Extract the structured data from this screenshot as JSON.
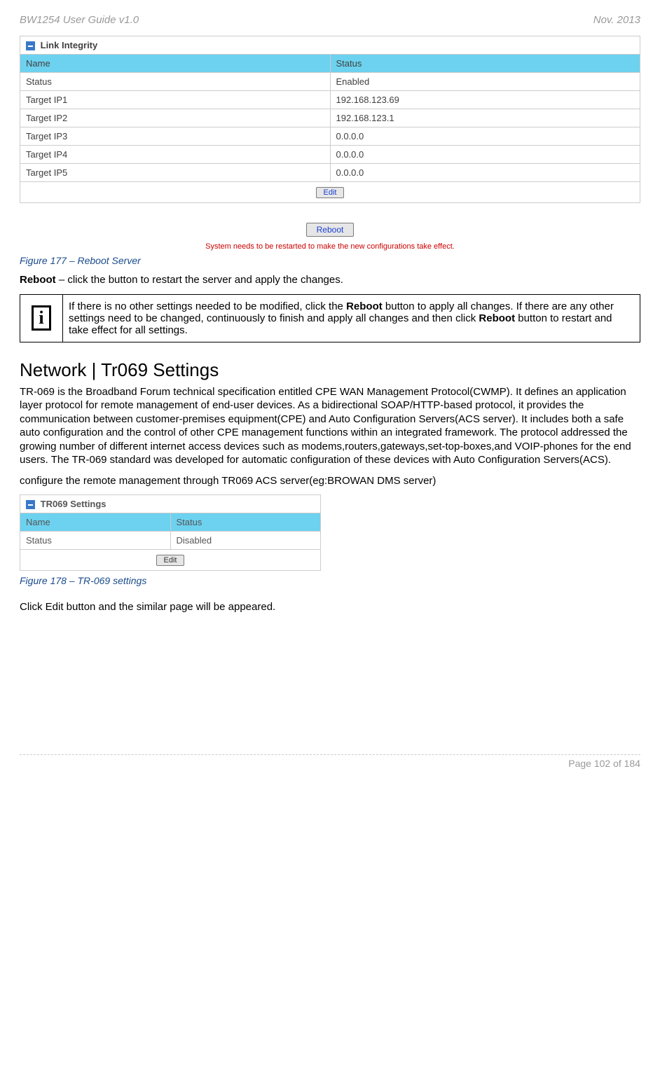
{
  "header": {
    "left": "BW1254 User Guide v1.0",
    "right": "Nov.  2013"
  },
  "link_integrity": {
    "title": "Link Integrity",
    "col1": "Name",
    "col2": "Status",
    "rows": [
      {
        "name": "Status",
        "value": "Enabled"
      },
      {
        "name": "Target IP1",
        "value": "192.168.123.69"
      },
      {
        "name": "Target IP2",
        "value": "192.168.123.1"
      },
      {
        "name": "Target IP3",
        "value": "0.0.0.0"
      },
      {
        "name": "Target IP4",
        "value": "0.0.0.0"
      },
      {
        "name": "Target IP5",
        "value": "0.0.0.0"
      }
    ],
    "edit_label": "Edit"
  },
  "reboot": {
    "button_label": "Reboot",
    "note": "System needs to be restarted to make the new configurations take effect."
  },
  "fig177": "Figure 177 – Reboot Server",
  "reboot_text": {
    "bold": "Reboot",
    "rest": " – click the button to restart the server and apply the changes."
  },
  "info_box": {
    "p1a": "If there is no other settings needed to be modified, click the ",
    "p1b": "Reboot",
    "p1c": " button to apply all changes. If there are any other settings need to be changed, continuously to finish and apply all changes and then click ",
    "p1d": "Reboot",
    "p1e": " button to restart and take effect  for all settings."
  },
  "section_title": "Network | Tr069 Settings",
  "tr069_para": "TR-069 is the Broadband Forum technical specification entitled CPE WAN Management Protocol(CWMP). It defines an application layer protocol for remote management of end-user devices. As a bidirectional SOAP/HTTP-based protocol, it provides the communication between customer-premises equipment(CPE) and Auto Configuration Servers(ACS server). It includes both a safe auto configuration and the control of other CPE management functions within an integrated framework. The protocol addressed the growing number of different internet access devices such as modems,routers,gateways,set-top-boxes,and VOIP-phones for the end users. The TR-069 standard was developed for automatic configuration of these devices with Auto Configuration Servers(ACS).",
  "tr069_para2": "configure the remote management through TR069 ACS server(eg:BROWAN DMS server)",
  "tr069_widget": {
    "title": "TR069 Settings",
    "col1": "Name",
    "col2": "Status",
    "row_name": "Status",
    "row_value": "Disabled",
    "edit_label": "Edit"
  },
  "fig178": "Figure 178 – TR-069 settings",
  "click_edit": "Click Edit button and the similar page will be appeared.",
  "footer": "Page 102 of 184"
}
